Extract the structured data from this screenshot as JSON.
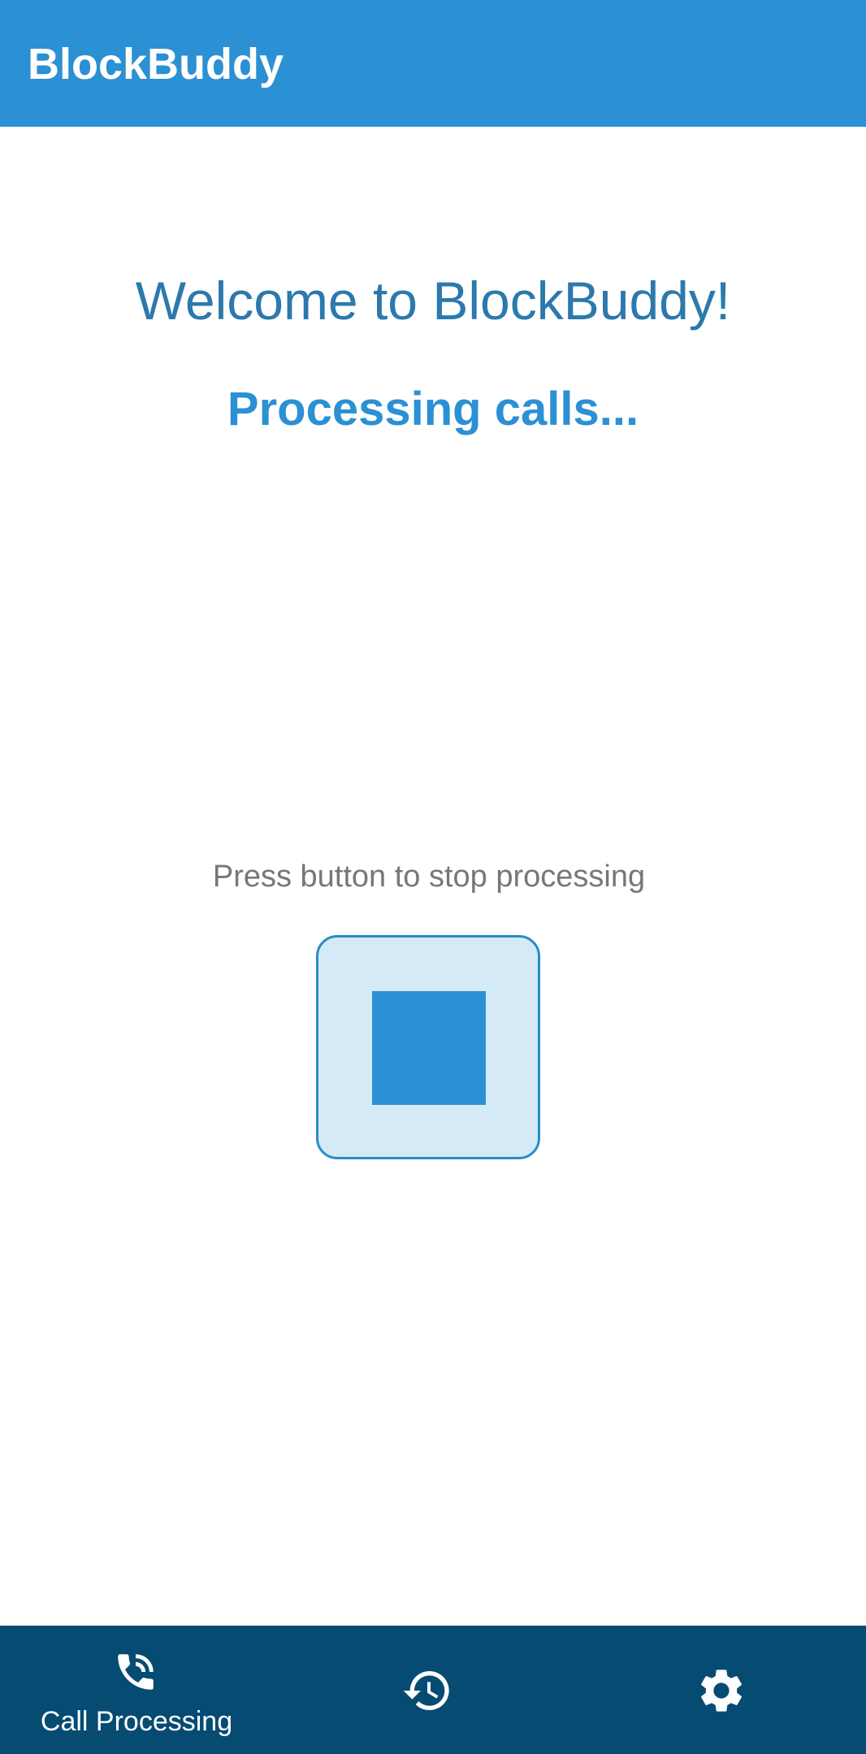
{
  "app_bar": {
    "title": "BlockBuddy",
    "background_color": "#2b90d4"
  },
  "main": {
    "welcome_text": "Welcome to BlockBuddy!",
    "status_text": "Processing calls...",
    "hint_text": "Press button to stop processing",
    "stop_button": {
      "icon": "stop-icon",
      "accent_color": "#2b90d4"
    }
  },
  "bottom_nav": {
    "background_color": "#064b72",
    "items": [
      {
        "icon": "phone-call-icon",
        "label": "Call Processing",
        "selected": true
      },
      {
        "icon": "history-icon",
        "label": "",
        "selected": false
      },
      {
        "icon": "settings-gear-icon",
        "label": "",
        "selected": false
      }
    ]
  }
}
